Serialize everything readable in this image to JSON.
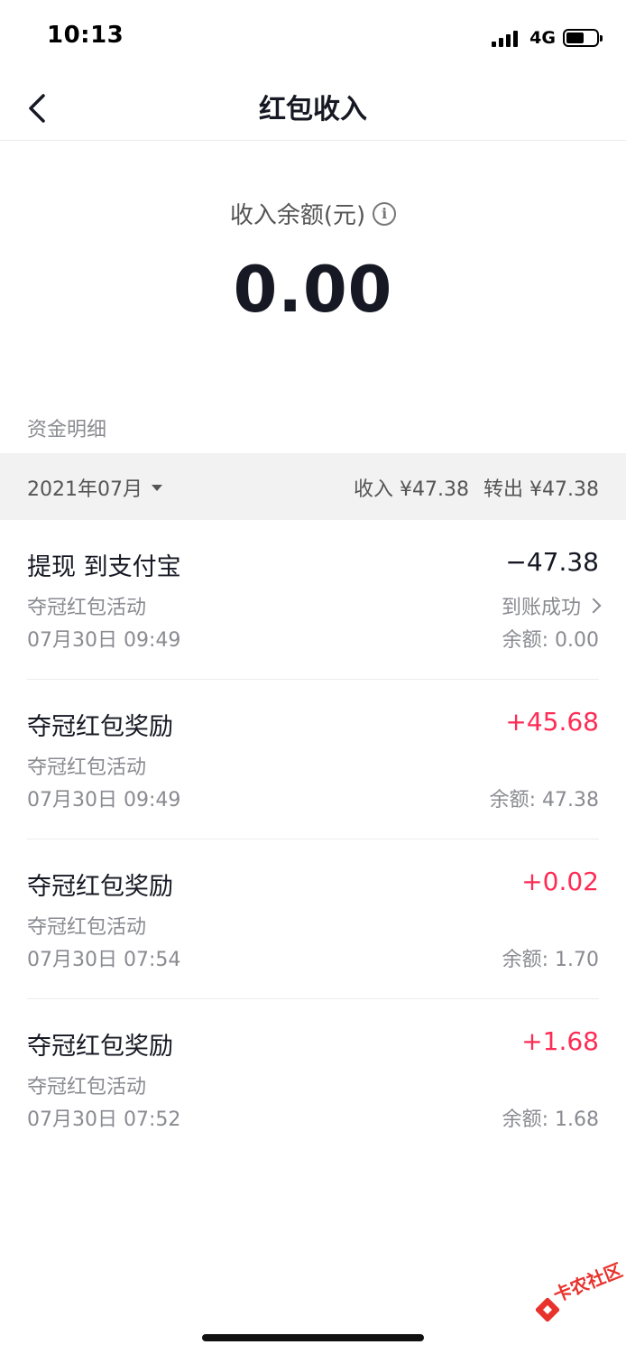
{
  "status_bar": {
    "time": "10:13",
    "network": "4G",
    "signal_bars": 4,
    "battery_level": 0.6
  },
  "nav": {
    "title": "红包收入",
    "back_icon": "chevron-left-icon"
  },
  "balance": {
    "label": "收入余额(元)",
    "info_icon": "info-icon",
    "amount": "0.00"
  },
  "details": {
    "section_title": "资金明细",
    "month": "2021年07月",
    "income_text": "收入 ¥47.38",
    "outgoing_text": "转出 ¥47.38"
  },
  "transactions": [
    {
      "title": "提现 到支付宝",
      "amount": "−47.38",
      "subtitle": "夺冠红包活动",
      "date": "07月30日 09:49",
      "status": "到账成功",
      "balance": "余额: 0.00"
    },
    {
      "title": "夺冠红包奖励",
      "amount": "+45.68",
      "subtitle": "夺冠红包活动",
      "date": "07月30日 09:49",
      "balance": "余额: 47.38"
    },
    {
      "title": "夺冠红包奖励",
      "amount": "+0.02",
      "subtitle": "夺冠红包活动",
      "date": "07月30日 07:54",
      "balance": "余额: 1.70"
    },
    {
      "title": "夺冠红包奖励",
      "amount": "+1.68",
      "subtitle": "夺冠红包活动",
      "date": "07月30日 07:52",
      "balance": "余额: 1.68"
    }
  ],
  "watermark": {
    "text": "卡农社区"
  },
  "colors": {
    "positive": "#fe2c55",
    "primary_text": "#161823",
    "secondary_text": "#8a8b91",
    "month_bar_bg": "#f2f2f2"
  }
}
